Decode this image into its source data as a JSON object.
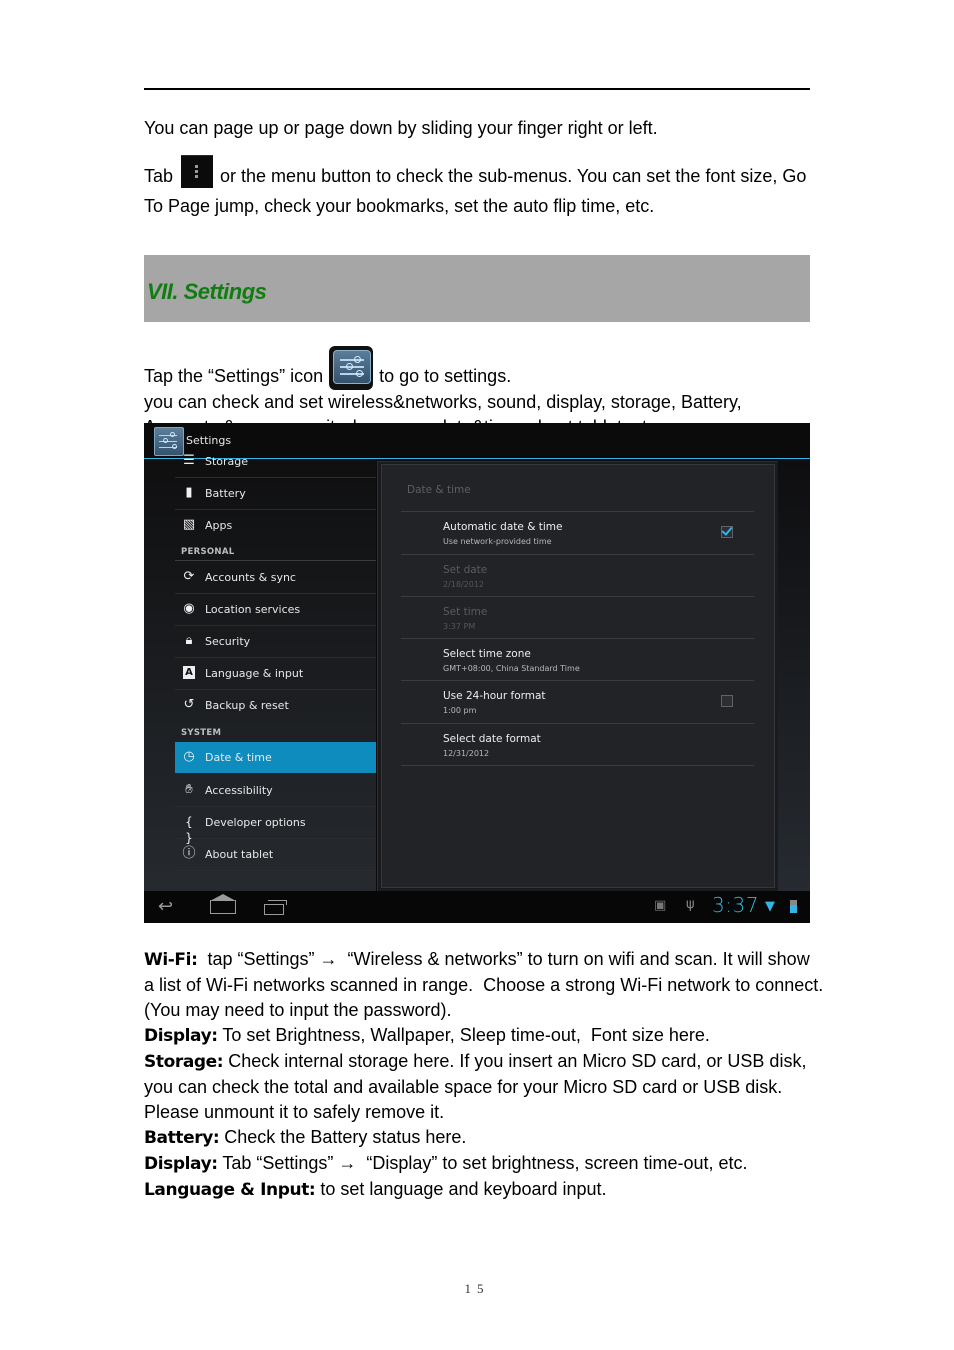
{
  "intro_paragraphs": {
    "page_swipe": "You can page up or page down by sliding your finger right or left.",
    "menu_prefix": "Tab",
    "menu_icon": "overflow-menu-icon",
    "menu_suffix": "or the menu button to check the sub-menus. You can set the font size, Go To Page jump, check your bookmarks, set the auto flip time, etc."
  },
  "section": {
    "title": "VII. Settings",
    "title_color": "#0f7d0f"
  },
  "settings_intro": {
    "prefix": "Tap the “Settings” icon",
    "icon": "settings-app-icon",
    "suffix": "to go to settings.",
    "line2": "you can check and set wireless&networks, sound, display, storage, Battery,",
    "line3": "Accounts &sync, security, language, date&time, about tablet, etc."
  },
  "screenshot": {
    "app_title": "Settings",
    "accent_color": "#33b5e5",
    "nav": {
      "items_top": [
        {
          "label": "Storage",
          "icon": "storage-icon"
        },
        {
          "label": "Battery",
          "icon": "battery-icon"
        },
        {
          "label": "Apps",
          "icon": "apps-icon"
        }
      ],
      "header_personal": "PERSONAL",
      "items_personal": [
        {
          "label": "Accounts & sync",
          "icon": "sync-icon"
        },
        {
          "label": "Location services",
          "icon": "location-icon"
        },
        {
          "label": "Security",
          "icon": "lock-icon"
        },
        {
          "label": "Language & input",
          "icon": "language-icon"
        },
        {
          "label": "Backup & reset",
          "icon": "backup-icon"
        }
      ],
      "header_system": "SYSTEM",
      "items_system": [
        {
          "label": "Date & time",
          "icon": "clock-icon",
          "selected": true
        },
        {
          "label": "Accessibility",
          "icon": "hand-icon"
        },
        {
          "label": "Developer options",
          "icon": "braces-icon"
        },
        {
          "label": "About tablet",
          "icon": "info-icon"
        }
      ]
    },
    "detail": {
      "title": "Date & time",
      "prefs": [
        {
          "title": "Automatic date & time",
          "summary": "Use network-provided time",
          "checkbox": true,
          "checked": true,
          "enabled": true
        },
        {
          "title": "Set date",
          "summary": "2/18/2012",
          "enabled": false
        },
        {
          "title": "Set time",
          "summary": "3:37 PM",
          "enabled": false
        },
        {
          "title": "Select time zone",
          "summary": "GMT+08:00, China Standard Time",
          "enabled": true
        },
        {
          "title": "Use 24-hour format",
          "summary": "1:00 pm",
          "checkbox": true,
          "checked": false,
          "enabled": true
        },
        {
          "title": "Select date format",
          "summary": "12/31/2012",
          "enabled": true
        }
      ]
    },
    "status_bar": {
      "clock": "3:37",
      "nav_buttons": [
        "back",
        "home",
        "recent-apps"
      ],
      "status_icons": [
        "android-debug-icon",
        "usb-icon",
        "wifi-icon",
        "battery-icon"
      ]
    }
  },
  "descriptions": [
    {
      "term": "Wi-Fi:",
      "text": "  tap “Settings” →  “Wireless & networks” to turn on wifi and scan. It will show a list of Wi-Fi networks scanned in range.  Choose a strong Wi-Fi network to connect. (You may need to input the password)."
    },
    {
      "term": "Display:",
      "text": " To set Brightness, Wallpaper, Sleep time-out,  Font size here."
    },
    {
      "term": "Storage:",
      "text": " Check internal storage here. If you insert an Micro SD card, or USB disk, you can check the total and available space for your Micro SD card or USB disk.  Please unmount it to safely remove it."
    },
    {
      "term": "Battery:",
      "text": " Check the Battery status here."
    },
    {
      "term": "Display:",
      "text": " Tab “Settings” →  “Display” to set brightness, screen time-out, etc."
    },
    {
      "term": "Language & Input:",
      "text": " to set language and keyboard input."
    }
  ],
  "page_number": "15"
}
